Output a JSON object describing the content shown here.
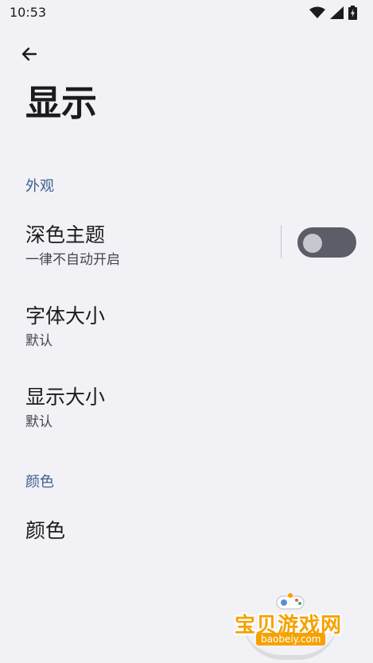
{
  "status_bar": {
    "time": "10:53",
    "icons": [
      "wifi-icon",
      "signal-icon",
      "battery-charging-icon"
    ]
  },
  "toolbar": {
    "back_icon": "arrow-left-icon"
  },
  "page": {
    "title": "显示"
  },
  "sections": {
    "appearance": {
      "header": "外观",
      "dark_theme": {
        "title": "深色主题",
        "summary": "一律不自动开启",
        "toggle_on": false
      },
      "font_size": {
        "title": "字体大小",
        "summary": "默认"
      },
      "display_size": {
        "title": "显示大小",
        "summary": "默认"
      }
    },
    "color": {
      "header": "颜色",
      "color_item": {
        "title": "颜色"
      }
    }
  },
  "watermark": {
    "text": "宝贝游戏网",
    "url": "baobeiy.com"
  },
  "colors": {
    "background": "#f2f1f6",
    "section_header": "#3e5f8f",
    "switch_track": "#5c5e67",
    "watermark": "#f5a200"
  }
}
